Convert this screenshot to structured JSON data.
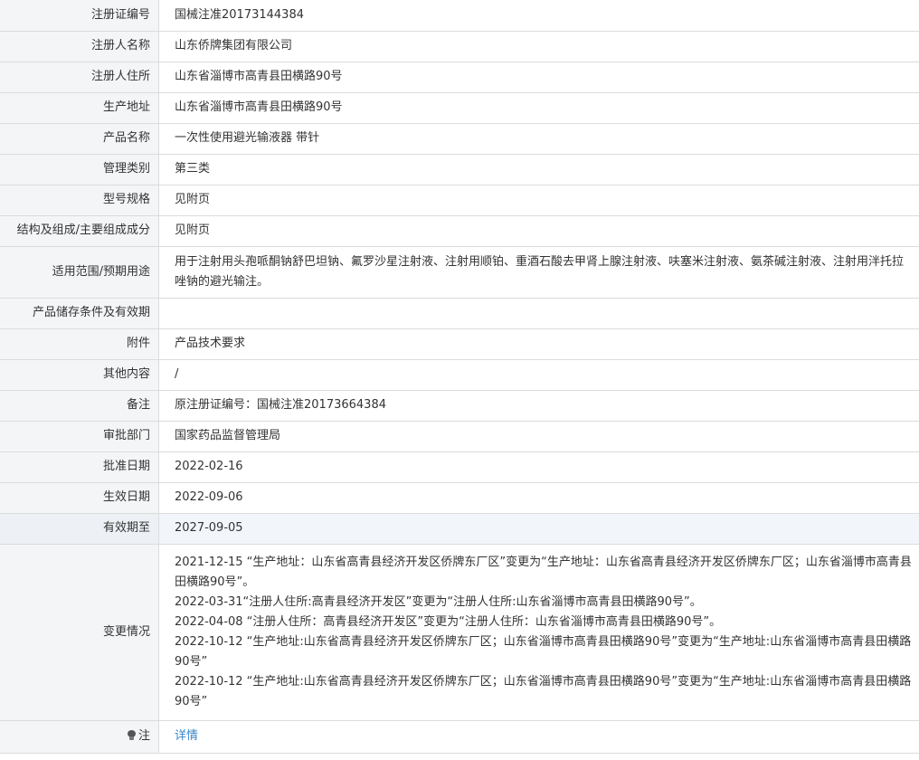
{
  "rows": [
    {
      "label": "注册证编号",
      "value": "国械注准20173144384"
    },
    {
      "label": "注册人名称",
      "value": "山东侨牌集团有限公司"
    },
    {
      "label": "注册人住所",
      "value": "山东省淄博市高青县田横路90号"
    },
    {
      "label": "生产地址",
      "value": "山东省淄博市高青县田横路90号"
    },
    {
      "label": "产品名称",
      "value": "一次性使用避光输液器 带针"
    },
    {
      "label": "管理类别",
      "value": "第三类"
    },
    {
      "label": "型号规格",
      "value": "见附页"
    },
    {
      "label": "结构及组成/主要组成成分",
      "value": "见附页"
    },
    {
      "label": "适用范围/预期用途",
      "value": "用于注射用头孢哌酮钠舒巴坦钠、氟罗沙星注射液、注射用顺铂、重酒石酸去甲肾上腺注射液、呋塞米注射液、氨茶碱注射液、注射用泮托拉唑钠的避光输注。"
    },
    {
      "label": "产品储存条件及有效期",
      "value": ""
    },
    {
      "label": "附件",
      "value": "产品技术要求"
    },
    {
      "label": "其他内容",
      "value": "/"
    },
    {
      "label": "备注",
      "value": "原注册证编号：国械注准20173664384"
    },
    {
      "label": "审批部门",
      "value": "国家药品监督管理局"
    },
    {
      "label": "批准日期",
      "value": "2022-02-16"
    },
    {
      "label": "生效日期",
      "value": "2022-09-06"
    },
    {
      "label": "有效期至",
      "value": "2027-09-05"
    }
  ],
  "changes": {
    "label": "变更情况",
    "entries": [
      "2021-12-15 “生产地址：山东省高青县经济开发区侨牌东厂区”变更为“生产地址：山东省高青县经济开发区侨牌东厂区；山东省淄博市高青县田横路90号”。",
      "2022-03-31“注册人住所:高青县经济开发区”变更为“注册人住所:山东省淄博市高青县田横路90号”。",
      "2022-04-08 “注册人住所：高青县经济开发区”变更为“注册人住所：山东省淄博市高青县田横路90号”。",
      "2022-10-12 “生产地址:山东省高青县经济开发区侨牌东厂区；山东省淄博市高青县田横路90号”变更为“生产地址:山东省淄博市高青县田横路90号”",
      "2022-10-12 “生产地址:山东省高青县经济开发区侨牌东厂区；山东省淄博市高青县田横路90号”变更为“生产地址:山东省淄博市高青县田横路90号”"
    ]
  },
  "note": {
    "icon": "bulb-icon",
    "label": "注",
    "link_text": "详情"
  }
}
